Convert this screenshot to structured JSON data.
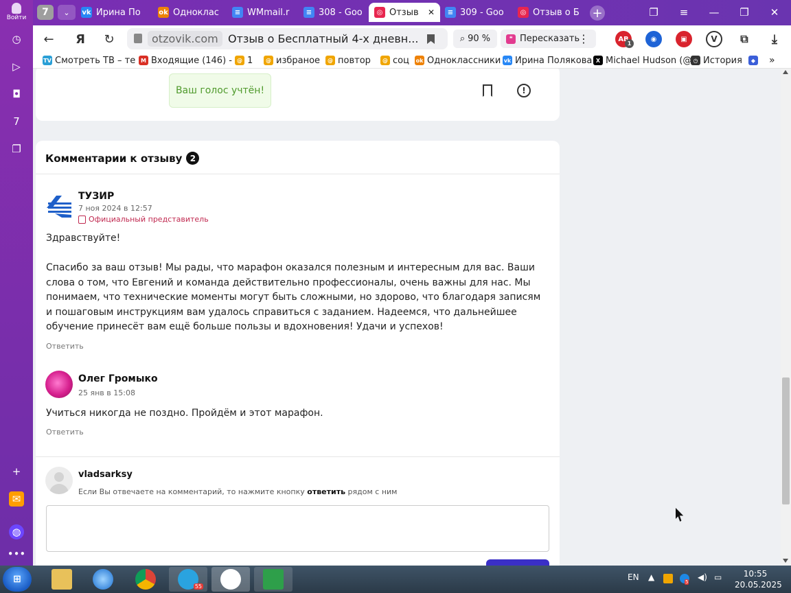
{
  "sidebar": {
    "login_label": "Войти"
  },
  "tabs": {
    "count": "7",
    "items": [
      {
        "label": "Ирина По",
        "color": "#2787f5",
        "glyph": "vk"
      },
      {
        "label": "Одноклас",
        "color": "#ee8208",
        "glyph": "ok"
      },
      {
        "label": "WMmail.r",
        "color": "#4285f4",
        "glyph": "≡"
      },
      {
        "label": "308 - Goo",
        "color": "#4285f4",
        "glyph": "≡"
      },
      {
        "label": "Отзыв",
        "color": "#e8264f",
        "glyph": "◎"
      },
      {
        "label": "309 - Goo",
        "color": "#4285f4",
        "glyph": "≡"
      },
      {
        "label": "Отзыв о Б",
        "color": "#e8264f",
        "glyph": "◎"
      }
    ]
  },
  "address": {
    "domain": "otzovik.com",
    "title": "Отзыв о Бесплатный 4-х дневн...",
    "zoom": "90 %",
    "retell": "Пересказать"
  },
  "extensions": {
    "abp_badge": "1"
  },
  "bookmarks": [
    {
      "label": "Смотреть ТВ – те",
      "color": "#2a9fd6",
      "glyph": "TV"
    },
    {
      "label": "Входящие (146) -",
      "color": "#d93025",
      "glyph": "M"
    },
    {
      "label": "1",
      "color": "#f0a500",
      "glyph": "@"
    },
    {
      "label": "избраное",
      "color": "#f0a500",
      "glyph": "@"
    },
    {
      "label": "повтор",
      "color": "#f0a500",
      "glyph": "@"
    },
    {
      "label": "соц",
      "color": "#f0a500",
      "glyph": "@"
    },
    {
      "label": "Одноклассники",
      "color": "#ee8208",
      "glyph": "ok"
    },
    {
      "label": "Ирина Полякова",
      "color": "#2787f5",
      "glyph": "vk"
    },
    {
      "label": "Michael Hudson (@",
      "color": "#000000",
      "glyph": "X"
    },
    {
      "label": "История",
      "color": "#333333",
      "glyph": "◷"
    }
  ],
  "vote_message": "Ваш голос учтён!",
  "comments": {
    "title": "Комментарии к отзыву",
    "count": "2",
    "items": [
      {
        "author": "ТУЗИР",
        "date": "7 ноя 2024 в 12:57",
        "badge": "Официальный представитель",
        "paragraphs": [
          "Здравствуйте!",
          "Спасибо за ваш отзыв! Мы рады, что марафон оказался полезным и интересным для вас. Ваши слова о том, что Евгений и команда действительно профессионалы, очень важны для нас. Мы понимаем, что технические моменты могут быть сложными, но здорово, что благодаря записям и пошаговым инструкциям вам удалось справиться с заданием. Надеемся, что дальнейшее обучение принесёт вам ещё больше пользы и вдохновения! Удачи и успехов!"
        ],
        "reply": "Ответить"
      },
      {
        "author": "Олег Громыко",
        "date": "25 янв в 15:08",
        "text": "Учиться никогда не поздно. Пройдём и этот марафон.",
        "reply": "Ответить"
      }
    ],
    "composer": {
      "user": "vladsarksy",
      "hint_before": "Если Вы отвечаете на комментарий, то нажмите кнопку",
      "hint_bold": "ответить",
      "hint_after": "рядом с ним"
    }
  },
  "taskbar": {
    "lang": "EN",
    "telegram_badge": "55",
    "tray_badge": "5",
    "time": "10:55",
    "date": "20.05.2025"
  }
}
